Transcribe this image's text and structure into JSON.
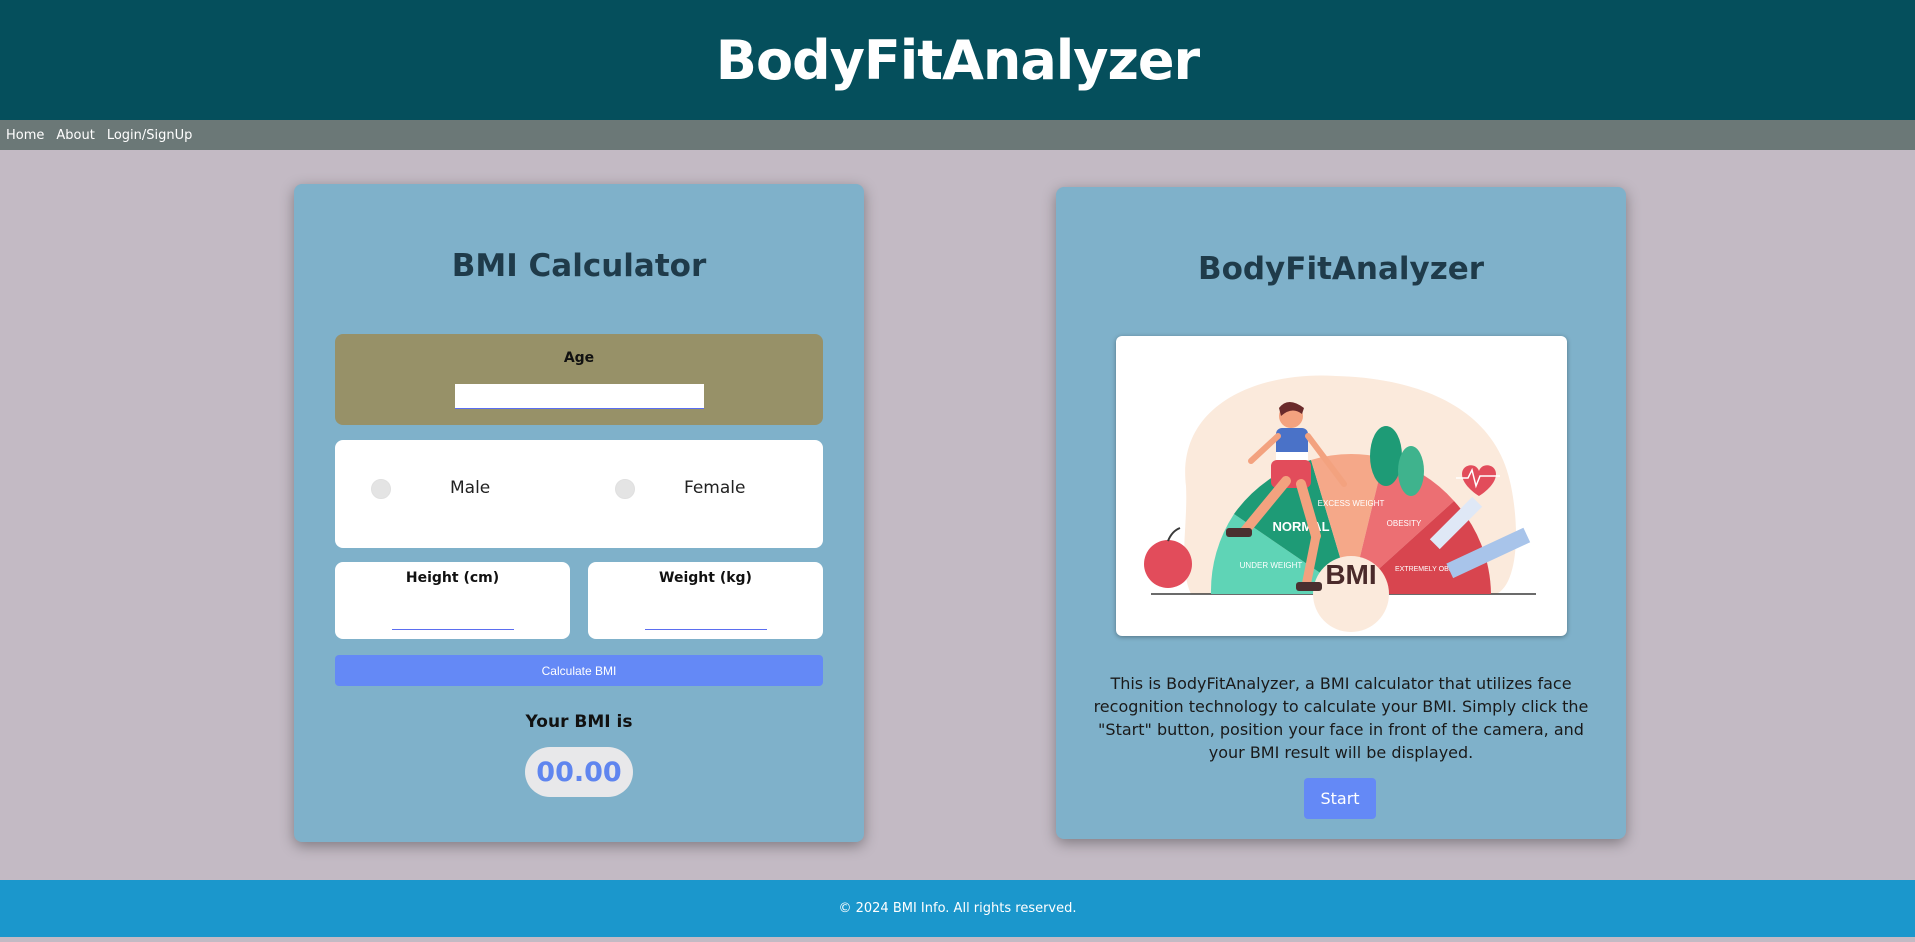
{
  "header": {
    "title": "BodyFitAnalyzer"
  },
  "nav": {
    "items": [
      "Home",
      "About",
      "Login/SignUp"
    ]
  },
  "calculator": {
    "title": "BMI Calculator",
    "age_label": "Age",
    "age_value": "",
    "gender_options": [
      "Male",
      "Female"
    ],
    "height_label": "Height (cm)",
    "weight_label": "Weight (kg)",
    "calculate_label": "Calculate BMI",
    "result_label": "Your BMI is",
    "result_value": "00.00"
  },
  "analyzer": {
    "title": "BodyFitAnalyzer",
    "illustration": {
      "segments": [
        "UNDER WEIGHT",
        "NORMAL",
        "EXCESS WEIGHT",
        "OBESITY",
        "EXTREMELY OBESITY"
      ],
      "center_label": "BMI"
    },
    "description": "This is BodyFitAnalyzer, a BMI calculator that utilizes face recognition technology to calculate your BMI. Simply click the \"Start\" button, position your face in front of the camera, and your BMI result will be displayed.",
    "start_label": "Start"
  },
  "footer": {
    "text": "© 2024 BMI Info. All rights reserved."
  },
  "colors": {
    "header_bg": "#054f5c",
    "nav_bg": "#6b7877",
    "page_bg": "#c3bac4",
    "card_bg": "#7fb1ca",
    "age_box_bg": "#979168",
    "button_bg": "#6489f6",
    "footer_bg": "#1b97cc"
  }
}
